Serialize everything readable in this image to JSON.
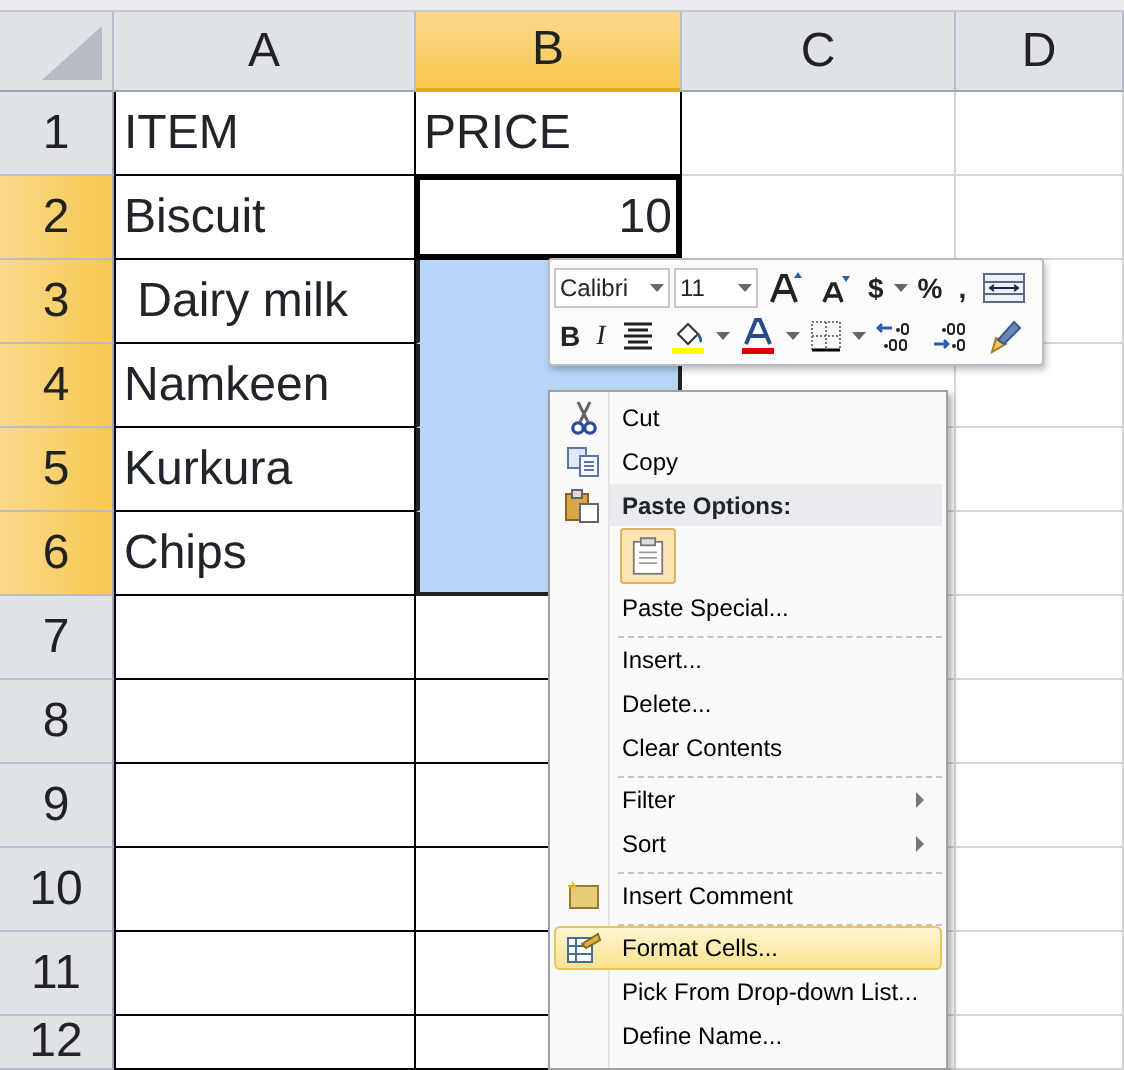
{
  "columns": [
    {
      "label": "A",
      "selected": false,
      "bordered": true
    },
    {
      "label": "B",
      "selected": true,
      "bordered": true
    },
    {
      "label": "C",
      "selected": false,
      "bordered": false
    },
    {
      "label": "D",
      "selected": false,
      "bordered": false
    }
  ],
  "rows": [
    {
      "header": "1",
      "selected": false,
      "cells": [
        {
          "text": "ITEM",
          "kind": "text"
        },
        {
          "text": "PRICE",
          "kind": "text"
        }
      ]
    },
    {
      "header": "2",
      "selected": true,
      "cells": [
        {
          "text": "Biscuit",
          "kind": "text"
        },
        {
          "text": "10",
          "kind": "number",
          "active": true
        }
      ]
    },
    {
      "header": "3",
      "selected": true,
      "cells": [
        {
          "text": " Dairy milk",
          "kind": "text"
        }
      ]
    },
    {
      "header": "4",
      "selected": true,
      "cells": [
        {
          "text": "Namkeen",
          "kind": "text"
        }
      ]
    },
    {
      "header": "5",
      "selected": true,
      "cells": [
        {
          "text": "Kurkura",
          "kind": "text"
        }
      ]
    },
    {
      "header": "6",
      "selected": true,
      "cells": [
        {
          "text": "Chips",
          "kind": "text"
        }
      ]
    },
    {
      "header": "7",
      "selected": false,
      "cells": []
    },
    {
      "header": "8",
      "selected": false,
      "cells": []
    },
    {
      "header": "9",
      "selected": false,
      "cells": []
    },
    {
      "header": "10",
      "selected": false,
      "cells": []
    },
    {
      "header": "11",
      "selected": false,
      "cells": []
    },
    {
      "header": "12",
      "selected": false,
      "cells": []
    }
  ],
  "mini_toolbar": {
    "font": "Calibri",
    "size": "11",
    "currency": "$",
    "percent": "%",
    "comma": ",",
    "bold": "B",
    "italic": "I"
  },
  "context_menu": [
    {
      "kind": "item",
      "text": "Cut",
      "selected": false
    },
    {
      "kind": "item",
      "text": "Copy",
      "selected": false
    },
    {
      "kind": "header",
      "text": "Paste Options:"
    },
    {
      "kind": "paste-options"
    },
    {
      "kind": "item",
      "text": "Paste Special...",
      "selected": false
    },
    {
      "kind": "separator"
    },
    {
      "kind": "item",
      "text": "Insert...",
      "selected": false
    },
    {
      "kind": "item",
      "text": "Delete...",
      "selected": false
    },
    {
      "kind": "item",
      "text": "Clear Contents",
      "selected": false
    },
    {
      "kind": "separator"
    },
    {
      "kind": "item",
      "text": "Filter",
      "submenu": true,
      "selected": false
    },
    {
      "kind": "item",
      "text": "Sort",
      "submenu": true,
      "selected": false
    },
    {
      "kind": "separator"
    },
    {
      "kind": "item",
      "text": "Insert Comment",
      "selected": false
    },
    {
      "kind": "separator"
    },
    {
      "kind": "item",
      "text": "Format Cells...",
      "selected": true
    },
    {
      "kind": "item",
      "text": "Pick From Drop-down List...",
      "selected": false
    },
    {
      "kind": "item",
      "text": "Define Name...",
      "selected": false
    }
  ]
}
